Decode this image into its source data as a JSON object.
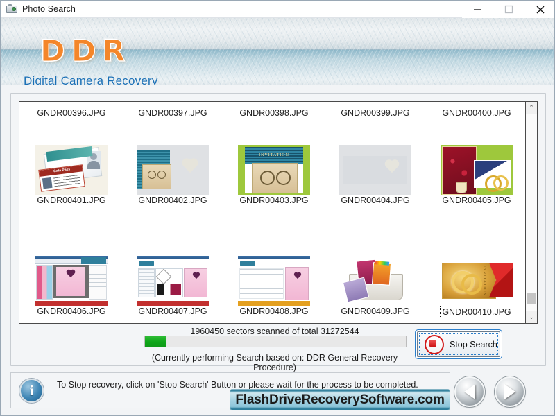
{
  "window": {
    "title": "Photo Search",
    "icon": "camera-icon",
    "minimize_label": "Minimize",
    "maximize_label": "Maximize",
    "close_label": "Close"
  },
  "banner": {
    "logo": "DDR",
    "subtitle": "Digital Camera Recovery",
    "logo_color": "#f4862a",
    "subtitle_color": "#1a6fb5"
  },
  "file_list": {
    "rows": [
      {
        "labels_top": [
          "GNDR00396.JPG",
          "GNDR00397.JPG",
          "GNDR00398.JPG",
          "GNDR00399.JPG",
          "GNDR00400.JPG"
        ]
      }
    ],
    "items": [
      {
        "label": "GNDR00401.JPG",
        "art": "t-gatepass",
        "focused": false
      },
      {
        "label": "GNDR00402.JPG",
        "art": "t-env",
        "focused": false
      },
      {
        "label": "GNDR00403.JPG",
        "art": "t-invite",
        "focused": false
      },
      {
        "label": "GNDR00404.JPG",
        "art": "t-blank",
        "focused": false
      },
      {
        "label": "GNDR00405.JPG",
        "art": "t-collage",
        "focused": false
      },
      {
        "label": "GNDR00406.JPG",
        "art": "t-app1",
        "focused": false
      },
      {
        "label": "GNDR00407.JPG",
        "art": "t-app2",
        "focused": false
      },
      {
        "label": "GNDR00408.JPG",
        "art": "t-app3",
        "focused": false
      },
      {
        "label": "GNDR00409.JPG",
        "art": "t-cards",
        "focused": false
      },
      {
        "label": "GNDR00410.JPG",
        "art": "t-gold",
        "focused": true
      }
    ],
    "scrollbar": {
      "up_glyph": "⌃",
      "down_glyph": "⌄"
    }
  },
  "progress": {
    "scanned_sectors": "1960450",
    "total_sectors": "31272544",
    "status_line": "1960450 sectors scanned of total 31272544",
    "sub_line": "(Currently performing Search based on:  DDR General Recovery Procedure)",
    "percent": 6,
    "fill_color": "#0ea518"
  },
  "stop_button": {
    "label": "Stop Search",
    "icon": "stop-square-icon"
  },
  "info_bar": {
    "icon": "info-icon",
    "icon_glyph": "i",
    "message": "To Stop recovery, click on 'Stop Search' Button or please wait for the process to be completed."
  },
  "brand": {
    "text": "FlashDriveRecoverySoftware.com"
  },
  "nav": {
    "prev_label": "Previous",
    "next_label": "Next"
  }
}
